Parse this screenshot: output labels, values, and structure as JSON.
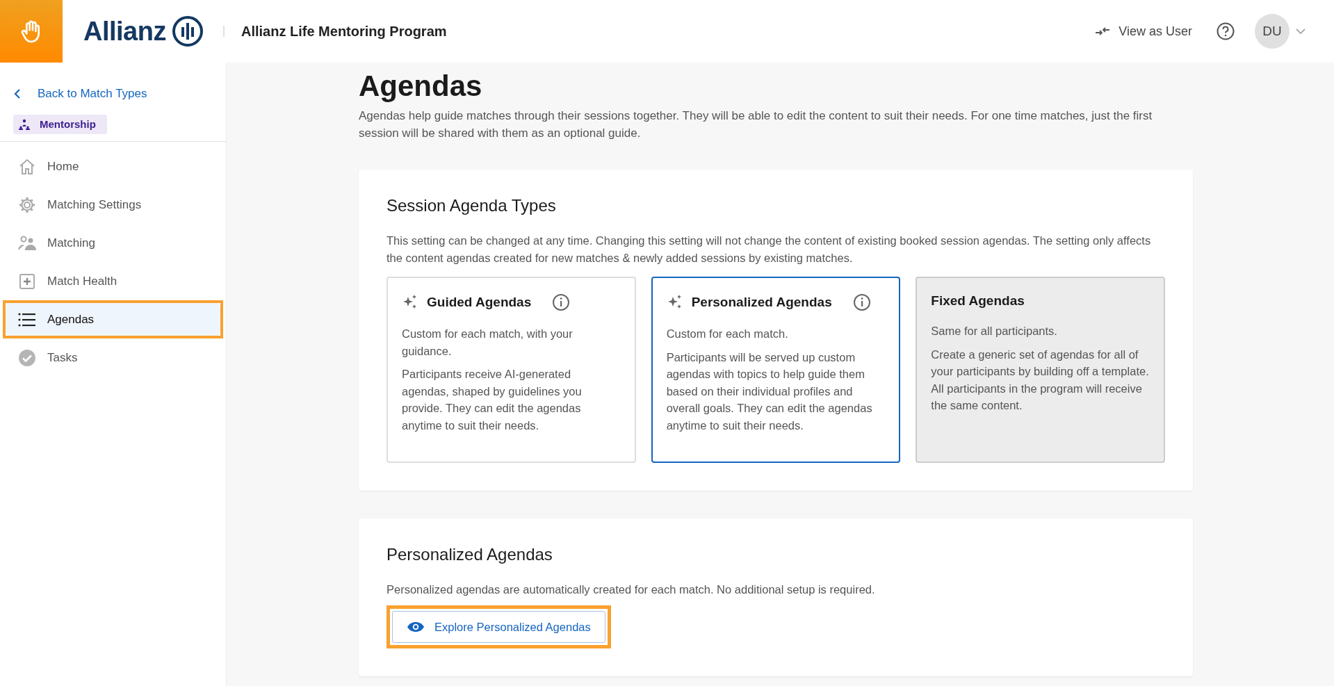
{
  "header": {
    "brand": "Allianz",
    "program": "Allianz Life Mentoring Program",
    "view_as_user": "View as User",
    "avatar": "DU"
  },
  "sidebar": {
    "back": "Back to Match Types",
    "badge": "Mentorship",
    "items": [
      {
        "label": "Home",
        "kind": "home",
        "selected": false,
        "highlighted": false
      },
      {
        "label": "Matching Settings",
        "kind": "gear",
        "selected": false,
        "highlighted": false
      },
      {
        "label": "Matching",
        "kind": "people",
        "selected": false,
        "highlighted": false
      },
      {
        "label": "Match Health",
        "kind": "plus",
        "selected": false,
        "highlighted": false
      },
      {
        "label": "Agendas",
        "kind": "list",
        "selected": true,
        "highlighted": true
      },
      {
        "label": "Tasks",
        "kind": "check",
        "selected": false,
        "highlighted": false
      }
    ]
  },
  "page": {
    "title": "Agendas",
    "description": "Agendas help guide matches through their sessions together. They will be able to edit the content to suit their needs. For one time matches, just the first session will be shared with them as an optional guide."
  },
  "types_card": {
    "title": "Session Agenda Types",
    "description": "This setting can be changed at any time. Changing this setting will not change the content of existing booked session agendas. The setting only affects the content agendas created for new matches & newly added sessions by existing matches.",
    "options": [
      {
        "kind": "ai",
        "title": "Guided Agendas",
        "summary": "Custom for each match, with your guidance.",
        "detail": "Participants receive AI-generated agendas, shaped by guidelines you provide. They can edit the agendas anytime to suit their needs.",
        "selected": false,
        "disabled": false
      },
      {
        "kind": "ai",
        "title": "Personalized Agendas",
        "summary": "Custom for each match.",
        "detail": "Participants will be served up custom agendas with topics to help guide them based on their individual profiles and overall goals. They can edit the agendas anytime to suit their needs.",
        "selected": true,
        "disabled": false
      },
      {
        "kind": "plain",
        "title": "Fixed Agendas",
        "summary": "Same for all participants.",
        "detail": "Create a generic set of agendas for all of your participants by building off a template. All participants in the program will receive the same content.",
        "selected": false,
        "disabled": true
      }
    ]
  },
  "personalized_card": {
    "title": "Personalized Agendas",
    "description": "Personalized agendas are automatically created for each match. No additional setup is required.",
    "button": {
      "label": "Explore Personalized Agendas",
      "highlighted": true
    }
  }
}
